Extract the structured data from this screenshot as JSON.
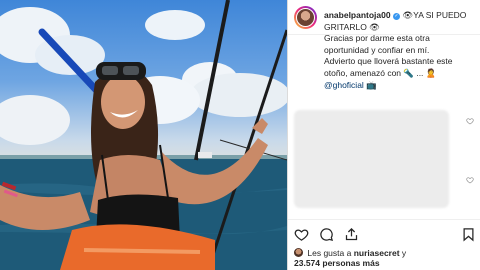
{
  "post": {
    "username": "anabelpantoja00",
    "verified_mark": "✓",
    "caption_line1": "👁YA SI PUEDO",
    "caption_line2": "GRITARLO 👁",
    "caption_line3": "Gracias por darme esta otra",
    "caption_line4": "oportunidad y confiar en mí.",
    "caption_line5": "Advierto que lloverá bastante este",
    "caption_line6": "otoño, amenazó con 🔦 ... 🙎",
    "mention": "@ghoficial",
    "mention_suffix": "📺"
  },
  "likes": {
    "line1_prefix": "Les gusta a",
    "line1_user": "nuriasecret",
    "line1_suffix": "y",
    "count": "23.574",
    "count_suffix": "personas más"
  },
  "icons": {
    "like": "heart-icon",
    "comment": "comment-icon",
    "share": "share-icon",
    "save": "bookmark-icon"
  },
  "colors": {
    "link": "#00376b",
    "verified": "#3897f0",
    "text": "#262626"
  }
}
